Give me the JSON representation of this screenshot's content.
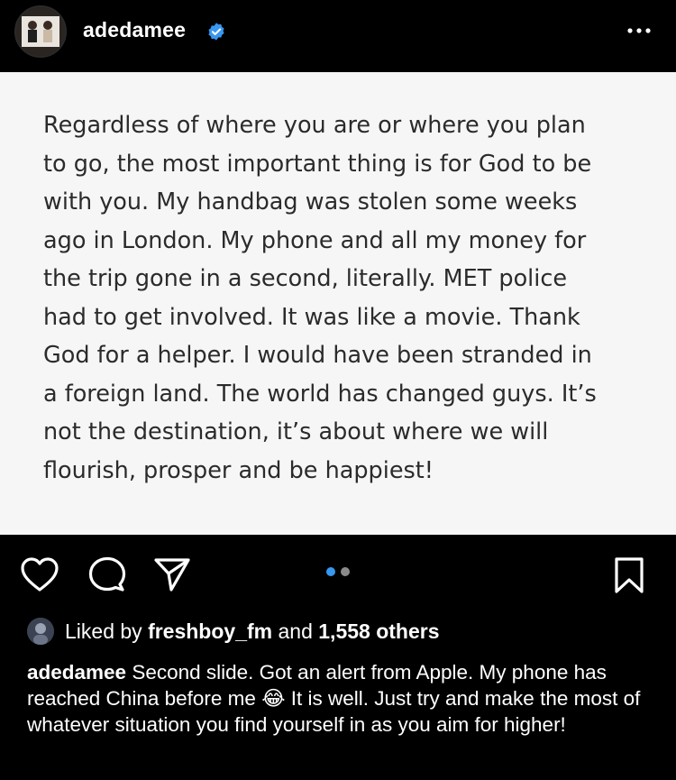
{
  "header": {
    "username": "adedamee",
    "verified_icon": "verified-badge-icon",
    "more_icon": "more-options-icon"
  },
  "slide": {
    "text": "Regardless of where you are or where you plan\nto go, the most important thing is for God to be\nwith you. My handbag was stolen some weeks\nago in London. My phone and all my money for\nthe trip gone in a second, literally. MET police\nhad to get involved. It was like a movie. Thank\nGod for a helper. I would have been stranded in\na foreign land. The world has changed guys. It’s\nnot the destination, it’s about where we will\nflourish, prosper and be happiest!"
  },
  "actions": {
    "icons": [
      "heart-icon",
      "comment-icon",
      "share-icon",
      "bookmark-icon"
    ],
    "carousel": {
      "current": 1,
      "total": 2
    },
    "active_dot_color": "#3897f0"
  },
  "likes": {
    "prefix": "Liked by",
    "liker": "freshboy_fm",
    "conjunction": "and",
    "others": "1,558 others"
  },
  "caption": {
    "username": "adedamee",
    "text_before_emoji": "Second slide. Got an alert from Apple. My phone has reached China before me",
    "emoji": "😂",
    "text_after_emoji": "It is well. Just try and make the most of whatever situation you find yourself in as you aim for higher!"
  },
  "colors": {
    "background": "#000000",
    "slide_background": "#f6f6f6",
    "slide_text": "#2b2b2b",
    "verified": "#3897f0"
  }
}
